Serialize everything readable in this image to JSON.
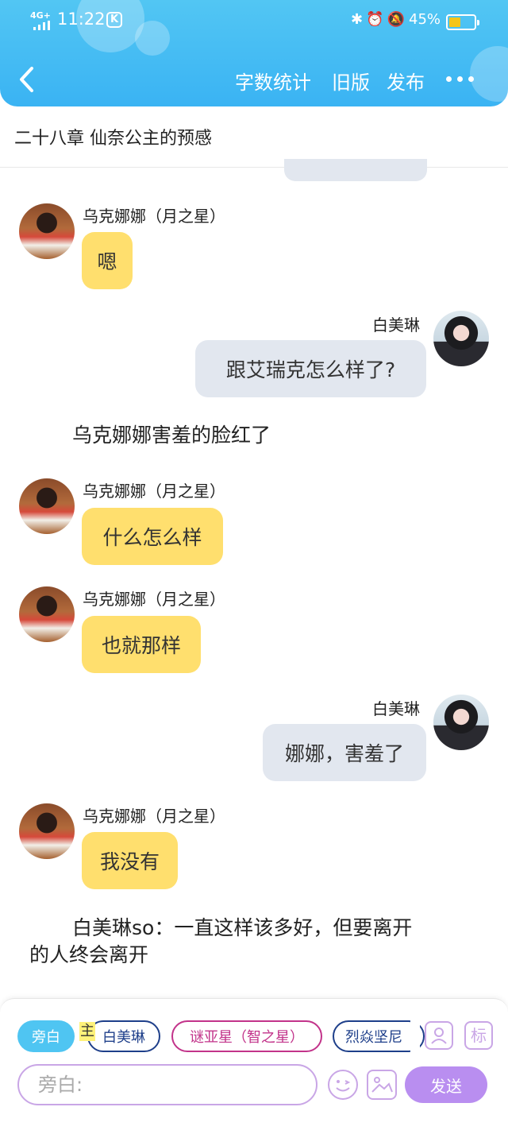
{
  "status_bar": {
    "network": "4G+",
    "time": "11:22",
    "app_badge": "K",
    "battery_percent": "45%",
    "battery_level": 0.45,
    "battery_color": "#f5c518",
    "icons": [
      "bluetooth-icon",
      "battery-saver-icon",
      "alarm-icon",
      "mute-icon"
    ]
  },
  "header": {
    "word_count": "字数统计",
    "old_version": "旧版",
    "publish": "发布",
    "accent": "#3ab3f3"
  },
  "chapter": {
    "title": "二十八章 仙奈公主的预感"
  },
  "messages": [
    {
      "type": "left",
      "speaker": "乌克娜娜（月之星）",
      "text": "嗯"
    },
    {
      "type": "right",
      "speaker": "白美琳",
      "text": "跟艾瑞克怎么样了?"
    },
    {
      "type": "narration",
      "text": "乌克娜娜害羞的脸红了"
    },
    {
      "type": "left",
      "speaker": "乌克娜娜（月之星）",
      "text": "什么怎么样"
    },
    {
      "type": "left",
      "speaker": "乌克娜娜（月之星）",
      "text": "也就那样"
    },
    {
      "type": "right",
      "speaker": "白美琳",
      "text": "娜娜，害羞了"
    },
    {
      "type": "left",
      "speaker": "乌克娜娜（月之星）",
      "text": "我没有"
    },
    {
      "type": "narration",
      "text_line1": "白美琳so：一直这样该多好，但要离开",
      "text_line2": "的人终会离开"
    }
  ],
  "composer": {
    "chips": [
      "旁白",
      "白美琳",
      "谜亚星（智之星）",
      "烈焱坚尼"
    ],
    "owner_tag": "主",
    "biao_label": "标",
    "input_placeholder": "旁白:",
    "send_label": "发送"
  }
}
